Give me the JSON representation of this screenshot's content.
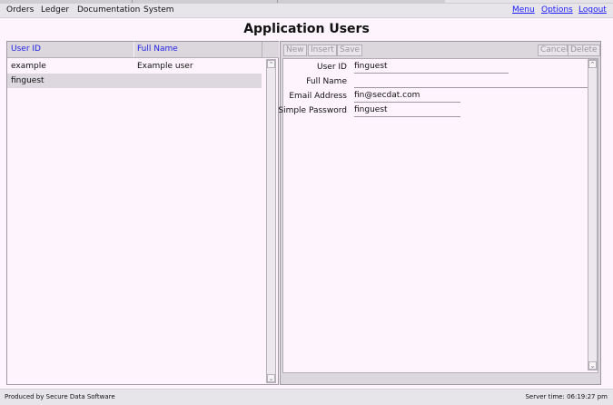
{
  "menubar": {
    "items": [
      "Orders",
      "Ledger",
      "Documentation",
      "System"
    ],
    "links": [
      "Menu",
      "Options",
      "Logout"
    ]
  },
  "page": {
    "title": "Application Users"
  },
  "users_table": {
    "columns": [
      "User ID",
      "Full Name"
    ],
    "rows": [
      {
        "user_id": "example",
        "full_name": "Example user"
      },
      {
        "user_id": "finguest",
        "full_name": ""
      }
    ],
    "selected_row": 1
  },
  "toolbar": {
    "new_label": "New",
    "insert_label": "Insert",
    "save_label": "Save",
    "cancel_label": "Cancel",
    "delete_label": "Delete"
  },
  "form": {
    "fields": [
      {
        "label": "User ID",
        "value": "finguest"
      },
      {
        "label": "Full Name",
        "value": ""
      },
      {
        "label": "Email Address",
        "value": "fin@secdat.com"
      },
      {
        "label": "Simple Password",
        "value": "finguest"
      }
    ]
  },
  "footer": {
    "left_text": "Produced by Secure Data Software",
    "right_text": "Server time: 06:19:27 pm"
  },
  "icons": {
    "scroll_up": "scroll-up-icon",
    "scroll_down": "scroll-down-icon"
  }
}
